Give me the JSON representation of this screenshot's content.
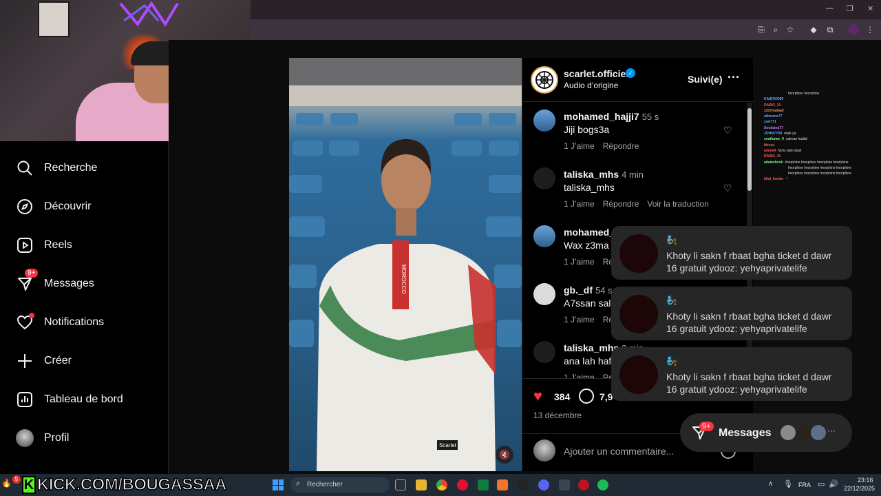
{
  "sidebar": {
    "items": [
      {
        "label": "Recherche",
        "icon": "search-icon"
      },
      {
        "label": "Découvrir",
        "icon": "compass-icon"
      },
      {
        "label": "Reels",
        "icon": "reels-icon"
      },
      {
        "label": "Messages",
        "icon": "messenger-icon",
        "badge": "9+"
      },
      {
        "label": "Notifications",
        "icon": "heart-icon"
      },
      {
        "label": "Créer",
        "icon": "plus-icon"
      },
      {
        "label": "Tableau de bord",
        "icon": "dashboard-icon"
      },
      {
        "label": "Profil",
        "icon": "avatar"
      }
    ]
  },
  "post": {
    "username": "scarlet.officiel",
    "subtitle": "Audio d’origine",
    "follow_label": "Suivi(e)",
    "likes": "384",
    "comments_count": "7,9",
    "date": "13 décembre",
    "comment_placeholder": "Ajouter un commentaire...",
    "shirt_text": "MOROCCO",
    "brand_tag": "Scarlet"
  },
  "comments": [
    {
      "user": "mohamed_hajji7",
      "time": "55 s",
      "text": "Jiji bogs3a",
      "actions": [
        "1 J’aime",
        "Répondre"
      ]
    },
    {
      "user": "taliska_mhs",
      "time": "4 min",
      "text": "taliska_mhs",
      "actions": [
        "1 J’aime",
        "Répondre",
        "Voir la traduction"
      ]
    },
    {
      "user": "mohamed_",
      "time": "",
      "text": "Wax z3ma t",
      "actions": [
        "1 J’aime",
        "Rép"
      ]
    },
    {
      "user": "gb._df",
      "time": "54 s",
      "text": "A7ssan saln",
      "actions": [
        "1 J’aime",
        "Rép"
      ]
    },
    {
      "user": "taliska_mhs",
      "time": "3 min",
      "text": "ana lah hafe",
      "actions": [
        "1 J’aime",
        "Rép"
      ]
    }
  ],
  "notifications": [
    {
      "emoji": "🧞",
      "line1": "Khoty li sakn f rbaat bgha ticket d dawr",
      "line2": "16 gratuit ydooz: yehyaprivatelife"
    },
    {
      "emoji": "🧞",
      "line1": "Khoty li sakn f rbaat bgha ticket d dawr",
      "line2": "16 gratuit ydooz: yehyaprivatelife"
    },
    {
      "emoji": "🧞",
      "line1": "Khoty li sakn f rbaat bgha ticket d dawr",
      "line2": "16 gratuit ydooz: yehyaprivatelife"
    }
  ],
  "messages_pill": {
    "label": "Messages",
    "badge": "9+",
    "more": "···"
  },
  "chat": [
    {
      "user": "",
      "text": "lmorphine lmorphine",
      "color": "#ffffff"
    },
    {
      "user": "KAIDOO999",
      "text": "",
      "color": "#5fa8ff"
    },
    {
      "user": "DARKI_10",
      "text": "",
      "color": "#ff5c5c"
    },
    {
      "user": "1337mafiaaf",
      "text": "",
      "color": "#ff8a3d"
    },
    {
      "user": "uthmane77",
      "text": "",
      "color": "#5fa8ff"
    },
    {
      "user": "zaxi771",
      "text": "",
      "color": "#5fa8ff"
    },
    {
      "user": "Soukaina77",
      "text": "",
      "color": "#c77dff"
    },
    {
      "user": "JOHNYY09",
      "text": "malk ya",
      "color": "#5fa8ff"
    },
    {
      "user": "soufianee_9",
      "text": "salman hadak",
      "color": "#7cfc7c"
    },
    {
      "user": "titreza",
      "text": "",
      "color": "#ff5c5c"
    },
    {
      "user": "amine9",
      "text": "Nchs alah dyali",
      "color": "#ff5c5c"
    },
    {
      "user": "DARKI_10",
      "text": "",
      "color": "#ff5c5c"
    },
    {
      "user": "adamxhxxb",
      "text": "lmorphine lmorphine lmorphine lmorphine",
      "color": "#7cfc7c"
    },
    {
      "user": "",
      "text": "lmorphine lmorphine lmorphine lmorphine",
      "color": "#ffffff"
    },
    {
      "user": "",
      "text": "lmorphine lmorphine lmorphine lmorphine",
      "color": "#ffffff"
    },
    {
      "user": "bilal_bondo",
      "text": "♡",
      "color": "#ff5c5c"
    }
  ],
  "taskbar": {
    "stream_url": "KICK.COM/BOUGASSAA",
    "badge": "5",
    "search_placeholder": "Rechercher",
    "lang": "FRA",
    "time": "23:16",
    "date": "22/12/2025"
  },
  "colors": {
    "accent_red": "#ff3040",
    "blue_verified": "#0095f6",
    "kick_green": "#53fc18"
  }
}
